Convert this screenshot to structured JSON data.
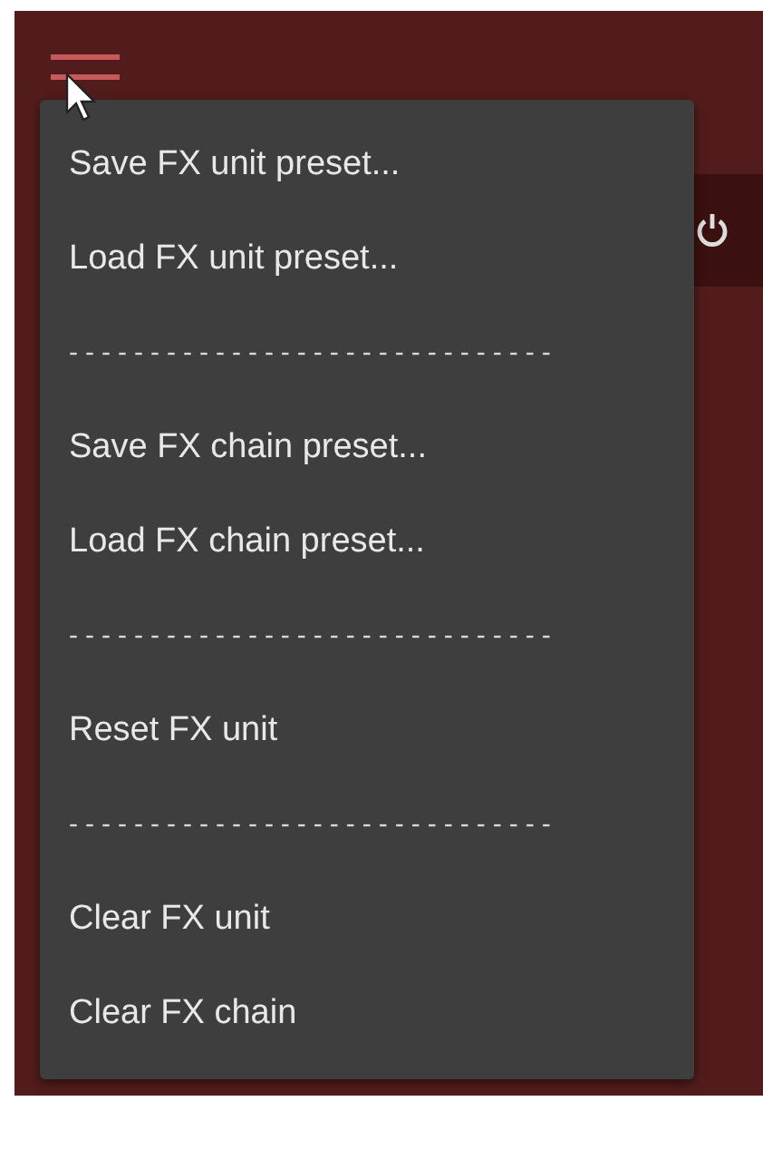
{
  "menu": {
    "items": [
      {
        "kind": "item",
        "label": "Save FX unit preset..."
      },
      {
        "kind": "item",
        "label": "Load FX unit preset..."
      },
      {
        "kind": "separator",
        "label": "------------------------------"
      },
      {
        "kind": "item",
        "label": "Save FX chain preset..."
      },
      {
        "kind": "item",
        "label": "Load FX chain preset..."
      },
      {
        "kind": "separator",
        "label": "------------------------------"
      },
      {
        "kind": "item",
        "label": "Reset FX unit"
      },
      {
        "kind": "separator",
        "label": "------------------------------"
      },
      {
        "kind": "item",
        "label": "Clear FX unit"
      },
      {
        "kind": "item",
        "label": "Clear FX chain"
      }
    ]
  }
}
